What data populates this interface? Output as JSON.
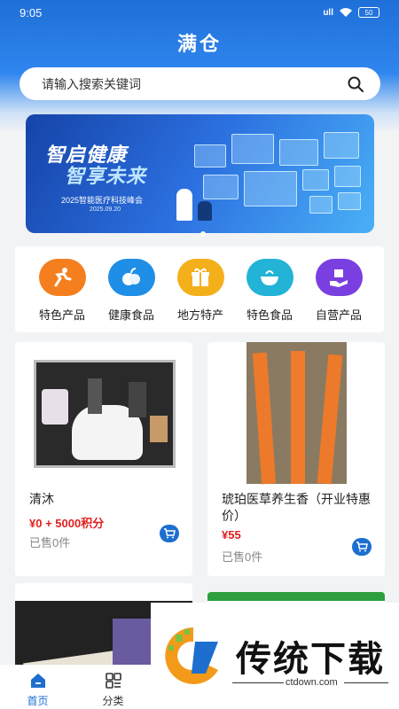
{
  "status": {
    "time": "9:05",
    "battery": "50",
    "signal": "ull"
  },
  "app": {
    "title": "满仓"
  },
  "search": {
    "placeholder": "请输入搜索关键词"
  },
  "banner": {
    "title1": "智启健康",
    "title2": "智享未来",
    "subtitle": "2025智能医疗科技峰会",
    "date": "2025.09.20"
  },
  "categories": [
    {
      "label": "特色产品",
      "color": "#f57f1f"
    },
    {
      "label": "健康食品",
      "color": "#1f8ee6"
    },
    {
      "label": "地方特产",
      "color": "#f4b01a"
    },
    {
      "label": "特色食品",
      "color": "#22b3d6"
    },
    {
      "label": "自营产品",
      "color": "#7a3fe0"
    }
  ],
  "products": [
    {
      "name": "清沐",
      "price": "¥0 + 5000积分",
      "sold": "已售0件"
    },
    {
      "name": "琥珀医草养生香（开业特惠价）",
      "price": "¥55",
      "sold": "已售0件"
    }
  ],
  "nav": [
    {
      "label": "首页",
      "color": "#1d6ecf"
    },
    {
      "label": "分类",
      "color": "#333333"
    }
  ],
  "watermark": {
    "text": "传统下载",
    "url": "ctdown.com"
  }
}
